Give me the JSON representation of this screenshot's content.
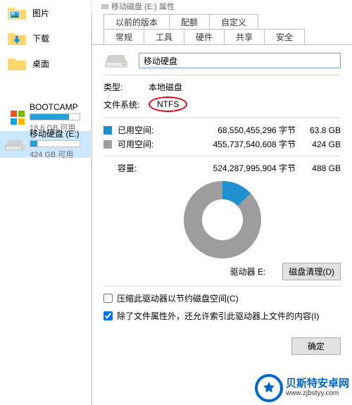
{
  "explorer": {
    "title_fragment": "移动磁盘 (E:) 属性",
    "quick_access": [
      {
        "label": "图片"
      },
      {
        "label": "下载"
      },
      {
        "label": "桌面"
      }
    ],
    "drives": [
      {
        "name": "BOOTCAMP",
        "sub": "18.6 GB 可用",
        "fill_pct": 78,
        "selected": false,
        "os": true
      },
      {
        "name": "移动硬盘 (E:)",
        "sub": "424 GB 可用",
        "fill_pct": 14,
        "selected": true,
        "os": false
      }
    ]
  },
  "dialog": {
    "tabs_row1": [
      "以前的版本",
      "配额",
      "自定义"
    ],
    "tabs_row2": [
      "常规",
      "工具",
      "硬件",
      "共享",
      "安全"
    ],
    "active_tab": "常规",
    "volume_name": "移动硬盘",
    "type_label": "类型:",
    "type_value": "本地磁盘",
    "fs_label": "文件系统:",
    "fs_value": "NTFS",
    "used_label": "已用空间:",
    "used_bytes": "68,550,455,296 字节",
    "used_hr": "63.8 GB",
    "free_label": "可用空间:",
    "free_bytes": "455,737,540,608 字节",
    "free_hr": "424 GB",
    "capacity_label": "容量:",
    "capacity_bytes": "524,287,995,904 字节",
    "capacity_hr": "488 GB",
    "drive_letter_label": "驱动器 E:",
    "cleanup_btn": "磁盘清理(D)",
    "compress_label": "压缩此驱动器以节约磁盘空间(C)",
    "index_label": "除了文件属性外，还允许索引此驱动器上文件的内容(I)",
    "ok_btn": "确定"
  },
  "watermark": {
    "title": "贝斯特安卓网",
    "url": "www.zjbstyy.com"
  },
  "chart_data": {
    "type": "pie",
    "title": "驱动器 E:",
    "series": [
      {
        "name": "已用空间",
        "value_bytes": 68550455296,
        "value_hr": "63.8 GB",
        "color": "#1e90d2"
      },
      {
        "name": "可用空间",
        "value_bytes": 455737540608,
        "value_hr": "424 GB",
        "color": "#9d9d9d"
      }
    ],
    "total_bytes": 524287995904,
    "total_hr": "488 GB"
  }
}
